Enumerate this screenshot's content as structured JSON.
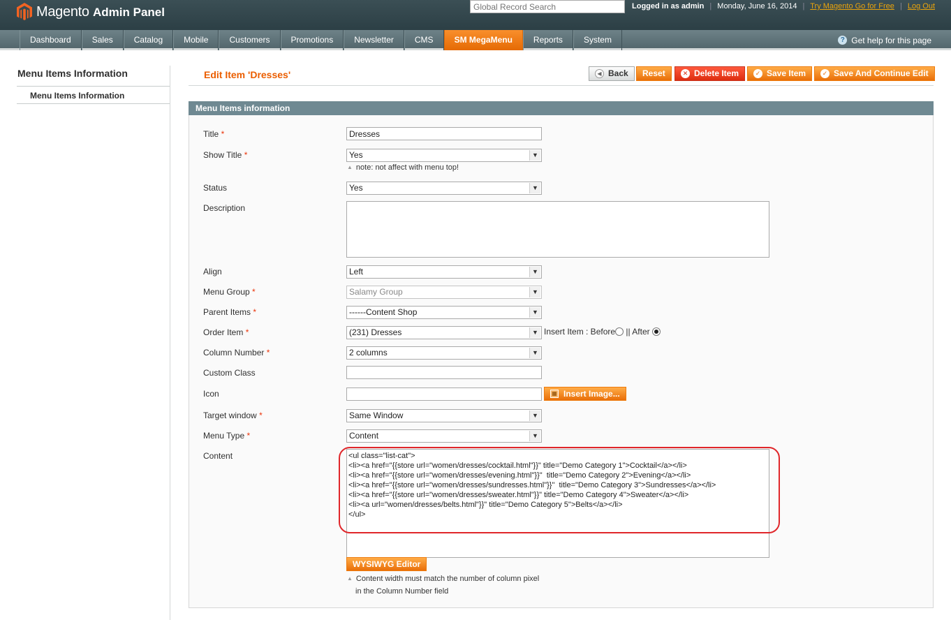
{
  "header": {
    "brand": "Magento",
    "brand_suffix": "Admin Panel",
    "search_placeholder": "Global Record Search",
    "logged_in": "Logged in as admin",
    "date": "Monday, June 16, 2014",
    "try_link": "Try Magento Go for Free",
    "logout_link": "Log Out"
  },
  "nav": {
    "items": [
      "Dashboard",
      "Sales",
      "Catalog",
      "Mobile",
      "Customers",
      "Promotions",
      "Newsletter",
      "CMS",
      "SM MegaMenu",
      "Reports",
      "System"
    ],
    "help": "Get help for this page"
  },
  "sidebar": {
    "title": "Menu Items Information",
    "item": "Menu Items Information"
  },
  "page": {
    "title": "Edit Item 'Dresses'",
    "buttons": {
      "back": "Back",
      "reset": "Reset",
      "delete": "Delete Item",
      "save": "Save Item",
      "save_continue": "Save And Continue Edit"
    },
    "section_title": "Menu Items information"
  },
  "form": {
    "title_label": "Title",
    "title_value": "Dresses",
    "show_title_label": "Show Title",
    "show_title_value": "Yes",
    "show_title_note": "note: not affect with menu top!",
    "status_label": "Status",
    "status_value": "Yes",
    "description_label": "Description",
    "align_label": "Align",
    "align_value": "Left",
    "menu_group_label": "Menu Group",
    "menu_group_value": "Salamy Group",
    "parent_items_label": "Parent Items",
    "parent_items_value": "------Content Shop",
    "order_item_label": "Order Item",
    "order_item_value": "(231) Dresses",
    "insert_item_label": "Insert Item : Before",
    "after_label": "|| After",
    "column_number_label": "Column Number",
    "column_number_value": "2 columns",
    "custom_class_label": "Custom Class",
    "icon_label": "Icon",
    "insert_image_button": "Insert Image...",
    "target_window_label": "Target window",
    "target_window_value": "Same Window",
    "menu_type_label": "Menu Type",
    "menu_type_value": "Content",
    "content_label": "Content",
    "content_value": "<ul class=\"list-cat\">\n<li><a href=\"{{store url=\"women/dresses/cocktail.html\"}}\" title=\"Demo Category 1\">Cocktail</a></li>\n<li><a href=\"{{store url=\"women/dresses/evening.html\"}}\"  title=\"Demo Category 2\">Evening</a></li>\n<li><a href=\"{{store url=\"women/dresses/sundresses.html\"}}\"  title=\"Demo Category 3\">Sundresses</a></li>\n<li><a href=\"{{store url=\"women/dresses/sweater.html\"}}\" title=\"Demo Category 4\">Sweater</a></li>\n<li><a url=\"women/dresses/belts.html\"}}\" title=\"Demo Category 5\">Belts</a></li>\n</ul>",
    "wysiwyg_button": "WYSIWYG Editor",
    "content_note_1": "Content width must match the number of column pixel",
    "content_note_2": "in the Column Number field",
    "required_mark": "*"
  }
}
